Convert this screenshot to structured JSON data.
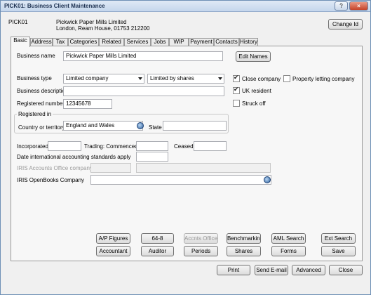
{
  "window": {
    "title": "PICK01: Business Client Maintenance",
    "help_btn": "?",
    "close_btn": "×"
  },
  "header": {
    "client_code": "PICK01",
    "client_name": "Pickwick Paper Mills Limited",
    "client_address": "London, Ream House, 01753 212200",
    "change_id": "Change Id"
  },
  "tabs": [
    "Basic",
    "Address",
    "Tax",
    "Categories",
    "Related",
    "Services",
    "Jobs",
    "WIP",
    "Payment",
    "Contacts",
    "History"
  ],
  "basic": {
    "business_name_label": "Business name",
    "business_name_value": "Pickwick Paper Mills Limited",
    "edit_names": "Edit Names",
    "business_type_label": "Business type",
    "business_type_value": "Limited company",
    "business_subtype_value": "Limited by shares",
    "business_desc_label": "Business description",
    "business_desc_value": "",
    "reg_number_label": "Registered number",
    "reg_number_value": "12345678",
    "close_company": "Close company",
    "close_company_checked": true,
    "property_letting": "Property letting company",
    "property_letting_checked": false,
    "uk_resident": "UK resident",
    "uk_resident_checked": true,
    "struck_off": "Struck off",
    "struck_off_checked": false,
    "registered_in_label": "Registered in",
    "country_label": "Country or territory",
    "country_value": "England and Wales",
    "state_label": "State",
    "state_value": "",
    "incorporated_label": "Incorporated",
    "trading_label": "Trading: Commenced",
    "ceased_label": "Ceased",
    "ias_label": "Date international accounting standards apply",
    "iris_accounts_label": "IRIS Accounts Office company",
    "iris_openbooks_label": "IRIS OpenBooks Company"
  },
  "bottom_buttons_row1": [
    "A/P Figures",
    "64-8",
    "Accnts Office",
    "Benchmarking",
    "AML Search",
    "Ext Search"
  ],
  "bottom_buttons_row2": [
    "Accountant",
    "Auditor",
    "Periods",
    "Shares",
    "Forms",
    "Save"
  ],
  "footer_buttons": [
    "Print",
    "Send E-mail",
    "Advanced",
    "Close"
  ]
}
